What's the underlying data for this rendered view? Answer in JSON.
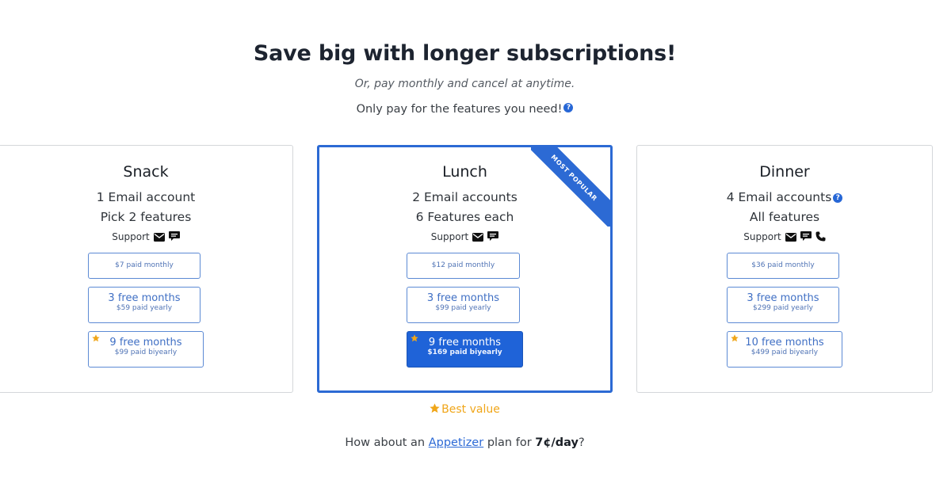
{
  "header": {
    "title": "Save big with longer subscriptions!",
    "subtitle": "Or, pay monthly and cancel at anytime.",
    "features_text": "Only pay for the features you need!",
    "help_glyph": "?"
  },
  "plans": [
    {
      "name": "Snack",
      "line1": "1 Email account",
      "line2": "Pick 2 features",
      "support_label": "Support",
      "support_icons": [
        "envelope-icon",
        "chat-icon"
      ],
      "options": {
        "monthly": "$7 paid monthly",
        "yearly_big": "3 free months",
        "yearly_small": "$59 paid yearly",
        "biyearly_big": "9 free months",
        "biyearly_small": "$99 paid biyearly"
      }
    },
    {
      "name": "Lunch",
      "line1": "2 Email accounts",
      "line2": "6 Features each",
      "support_label": "Support",
      "support_icons": [
        "envelope-icon",
        "chat-icon"
      ],
      "ribbon": "MOST POPULAR",
      "options": {
        "monthly": "$12 paid monthly",
        "yearly_big": "3 free months",
        "yearly_small": "$99 paid yearly",
        "biyearly_big": "9 free months",
        "biyearly_small": "$169 paid biyearly"
      }
    },
    {
      "name": "Dinner",
      "line1": "4 Email accounts",
      "line2": "All features",
      "support_label": "Support",
      "support_icons": [
        "envelope-icon",
        "chat-icon",
        "phone-icon"
      ],
      "options": {
        "monthly": "$36 paid monthly",
        "yearly_big": "3 free months",
        "yearly_small": "$299 paid yearly",
        "biyearly_big": "10 free months",
        "biyearly_small": "$499 paid biyearly"
      }
    }
  ],
  "footer": {
    "best_value": "Best value",
    "appetizer_pre": "How about an",
    "appetizer_link": "Appetizer",
    "appetizer_mid": "plan for",
    "appetizer_price": "7¢/day",
    "appetizer_post": "?"
  },
  "colors": {
    "accent": "#2c6ad4",
    "selected": "#1f63d8",
    "star": "#f0a619"
  }
}
